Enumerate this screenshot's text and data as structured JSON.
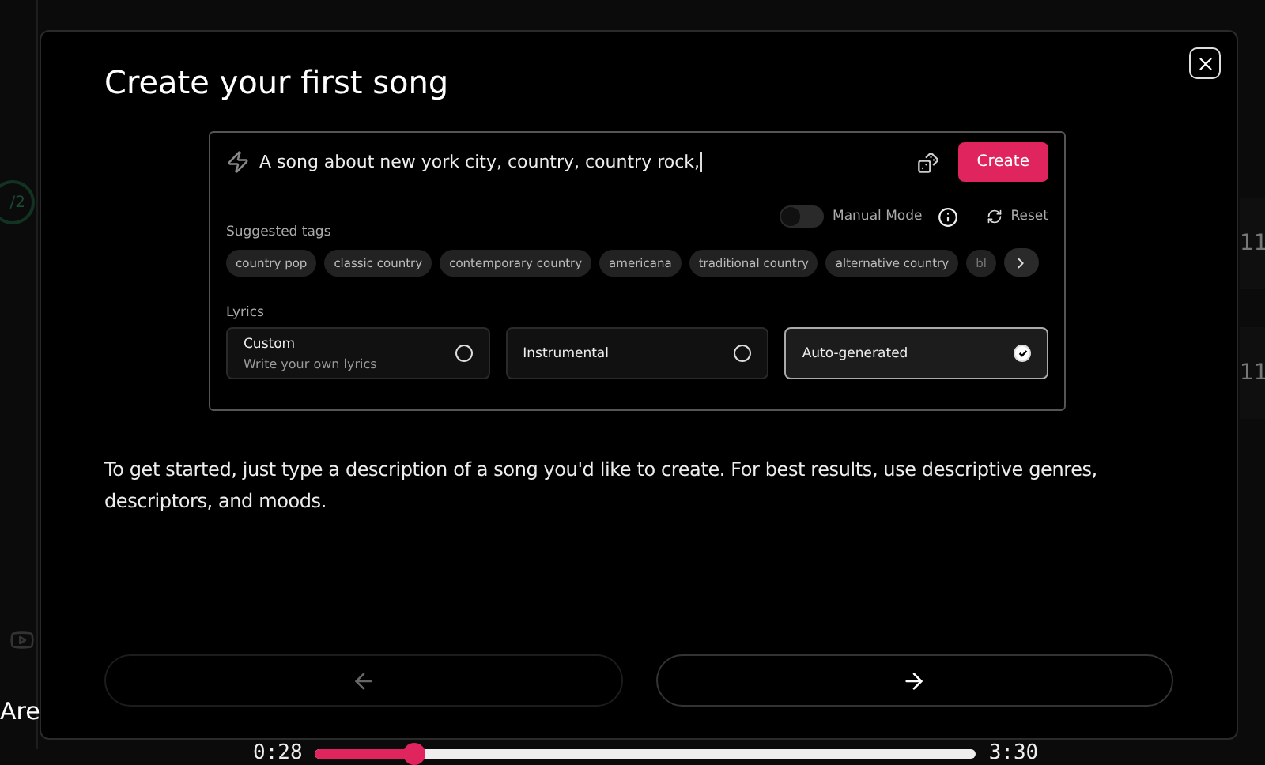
{
  "background": {
    "step_badge": "/2",
    "side_text": "Are",
    "row_values": [
      "11",
      "11"
    ],
    "player": {
      "elapsed": "0:28",
      "total": "3:30",
      "level": 0.15
    }
  },
  "dialog": {
    "title": "Create your first song",
    "preview": {
      "prompt": "A song about new york city, country, country rock,",
      "create_button": "Create",
      "manual_mode": {
        "label": "Manual Mode",
        "on": false
      },
      "reset": "Reset",
      "tags_label": "Suggested tags",
      "tags": [
        "country pop",
        "classic country",
        "contemporary country",
        "americana",
        "traditional country",
        "alternative country",
        "bl"
      ],
      "lyrics_label": "Lyrics",
      "lyrics_options": [
        {
          "title": "Custom",
          "subtitle": "Write your own lyrics",
          "selected": false
        },
        {
          "title": "Instrumental",
          "selected": false
        },
        {
          "title": "Auto-generated",
          "selected": true
        }
      ]
    },
    "description": "To get started, just type a description of a song you'd like to create. For best results, use descriptive genres, descriptors, and moods.",
    "nav": [
      {
        "kind": "back",
        "disabled": true
      },
      {
        "kind": "next",
        "disabled": false
      }
    ]
  }
}
